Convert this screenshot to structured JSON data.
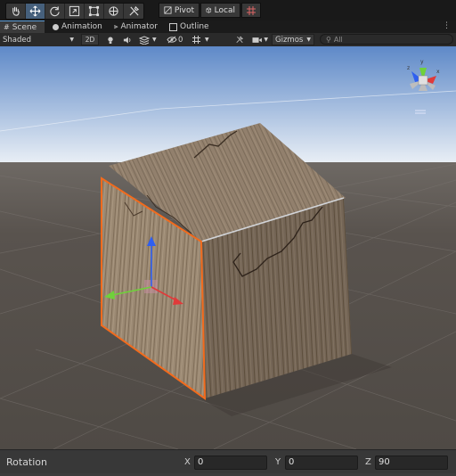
{
  "toolbar": {
    "tools": [
      {
        "name": "hand-tool-icon",
        "active": false
      },
      {
        "name": "move-tool-icon",
        "active": true
      },
      {
        "name": "rotate-tool-icon",
        "active": false
      },
      {
        "name": "scale-tool-icon",
        "active": false
      },
      {
        "name": "rect-tool-icon",
        "active": false
      },
      {
        "name": "transform-tool-icon",
        "active": false
      },
      {
        "name": "custom-tool-icon",
        "active": false
      }
    ],
    "pivot_label": "Pivot",
    "local_label": "Local"
  },
  "tabs": [
    {
      "label": "Scene",
      "icon": "scene-icon",
      "active": true
    },
    {
      "label": "Animation",
      "icon": "animation-icon",
      "active": false
    },
    {
      "label": "Animator",
      "icon": "animator-icon",
      "active": false
    },
    {
      "label": "Outline",
      "icon": "outline-icon",
      "active": false
    }
  ],
  "scene_toolbar": {
    "shading_mode": "Shaded",
    "mode_2d": "2D",
    "hidden_count": "0",
    "gizmos_label": "Gizmos",
    "search_placeholder": "All"
  },
  "inspector": {
    "label": "Rotation",
    "x_label": "X",
    "x_value": "0",
    "y_label": "Y",
    "y_value": "0",
    "z_label": "Z",
    "z_value": "90"
  },
  "colors": {
    "sky_top": "#5e89c8",
    "horizon": "#e8eef5",
    "ground": "#56504b",
    "selection_outline": "#f26b1d",
    "axis_x": "#e03a3a",
    "axis_y": "#2f5ff0",
    "axis_z": "#6fd13a",
    "active_tool": "#46607c"
  }
}
